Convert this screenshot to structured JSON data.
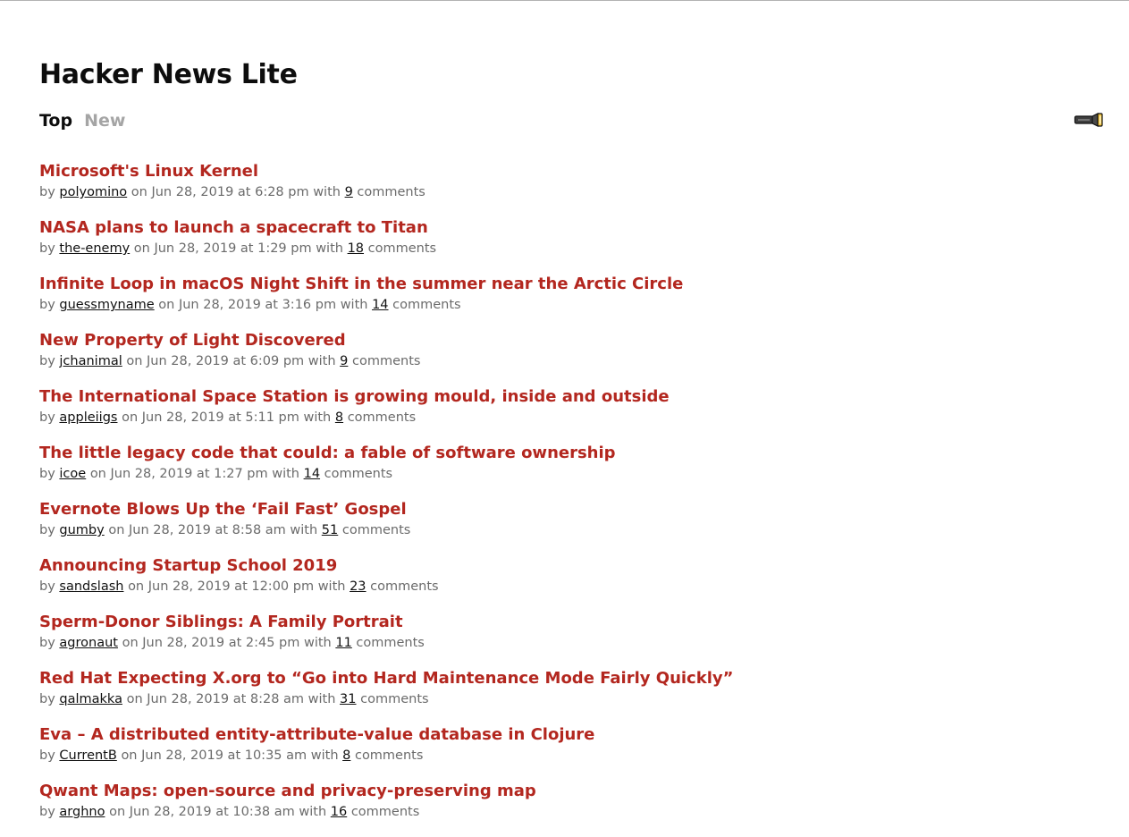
{
  "app": {
    "title": "Hacker News Lite"
  },
  "nav": {
    "tabs": [
      {
        "label": "Top",
        "active": true
      },
      {
        "label": "New",
        "active": false
      }
    ],
    "theme_toggle_icon": "flashlight-icon"
  },
  "meta_words": {
    "by": "by",
    "on": "on",
    "with": "with",
    "comments": "comments"
  },
  "colors": {
    "story_title": "#b3271f",
    "meta_text": "#6b6b6b",
    "inactive_tab": "#a5a5a5"
  },
  "stories": [
    {
      "title": "Microsoft's Linux Kernel",
      "author": "polyomino",
      "date": "Jun 28, 2019 at 6:28 pm",
      "comments": "9"
    },
    {
      "title": "NASA plans to launch a spacecraft to Titan",
      "author": "the-enemy",
      "date": "Jun 28, 2019 at 1:29 pm",
      "comments": "18"
    },
    {
      "title": "Infinite Loop in macOS Night Shift in the summer near the Arctic Circle",
      "author": "guessmyname",
      "date": "Jun 28, 2019 at 3:16 pm",
      "comments": "14"
    },
    {
      "title": "New Property of Light Discovered",
      "author": "jchanimal",
      "date": "Jun 28, 2019 at 6:09 pm",
      "comments": "9"
    },
    {
      "title": "The International Space Station is growing mould, inside and outside",
      "author": "appleiigs",
      "date": "Jun 28, 2019 at 5:11 pm",
      "comments": "8"
    },
    {
      "title": "The little legacy code that could: a fable of software ownership",
      "author": "icoe",
      "date": "Jun 28, 2019 at 1:27 pm",
      "comments": "14"
    },
    {
      "title": "Evernote Blows Up the ‘Fail Fast’ Gospel",
      "author": "gumby",
      "date": "Jun 28, 2019 at 8:58 am",
      "comments": "51"
    },
    {
      "title": "Announcing Startup School 2019",
      "author": "sandslash",
      "date": "Jun 28, 2019 at 12:00 pm",
      "comments": "23"
    },
    {
      "title": "Sperm-Donor Siblings: A Family Portrait",
      "author": "agronaut",
      "date": "Jun 28, 2019 at 2:45 pm",
      "comments": "11"
    },
    {
      "title": "Red Hat Expecting X.org to “Go into Hard Maintenance Mode Fairly Quickly”",
      "author": "qalmakka",
      "date": "Jun 28, 2019 at 8:28 am",
      "comments": "31"
    },
    {
      "title": "Eva – A distributed entity-attribute-value database in Clojure",
      "author": "CurrentB",
      "date": "Jun 28, 2019 at 10:35 am",
      "comments": "8"
    },
    {
      "title": "Qwant Maps: open-source and privacy-preserving map",
      "author": "arghno",
      "date": "Jun 28, 2019 at 10:38 am",
      "comments": "16"
    }
  ]
}
